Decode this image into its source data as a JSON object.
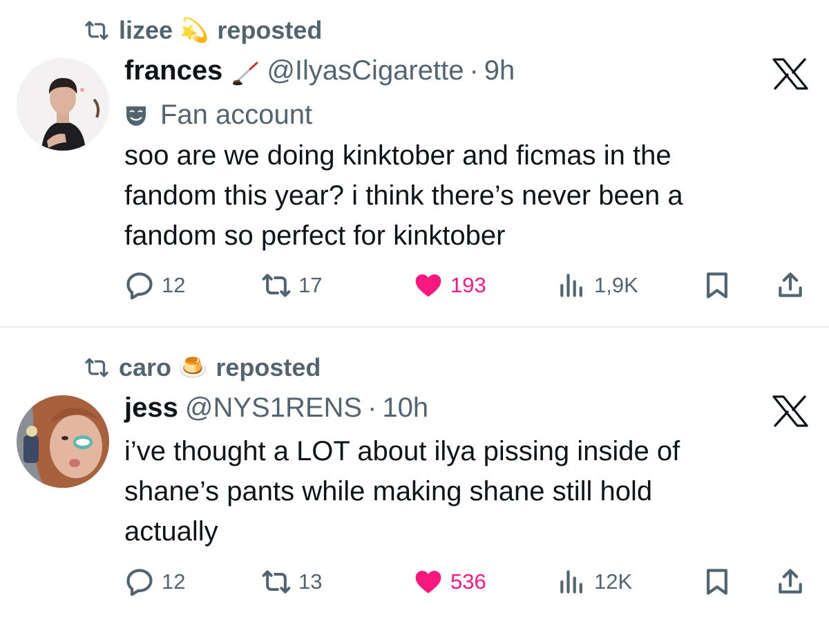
{
  "tweets": [
    {
      "repost": {
        "user": "lizee",
        "emoji": "💫",
        "text": "reposted"
      },
      "author": {
        "name": "frances",
        "handle": "@IlyasCigarette",
        "separator": "·",
        "time": "9h"
      },
      "label": "Fan account",
      "lines": [
        "soo are we doing kinktober and ficmas in the",
        "fandom this year? i think there’s never been a",
        "fandom so perfect for kinktober"
      ],
      "stats": {
        "replies": "12",
        "reposts": "17",
        "likes": "193",
        "views": "1,9K"
      }
    },
    {
      "repost": {
        "user": "caro",
        "emoji": "🍮",
        "text": "reposted"
      },
      "author": {
        "name": "jess",
        "handle": "@NYS1RENS",
        "separator": "·",
        "time": "10h"
      },
      "lines": [
        "i’ve thought a LOT about ilya pissing inside of",
        "shane’s pants while making shane still hold",
        "actually"
      ],
      "stats": {
        "replies": "12",
        "reposts": "13",
        "likes": "536",
        "views": "12K"
      }
    }
  ],
  "icons": {
    "repost": "repost-icon",
    "reply": "reply-icon",
    "like": "heart-icon",
    "views": "views-icon",
    "bookmark": "bookmark-icon",
    "share": "share-icon",
    "x_logo": "x-logo-icon",
    "fan_label": "theater-mask-icon",
    "hockey": "hockey-stick-icon"
  },
  "colors": {
    "text": "#0f1419",
    "secondary": "#536471",
    "like": "#f91880",
    "divider": "#e7e9ea"
  }
}
